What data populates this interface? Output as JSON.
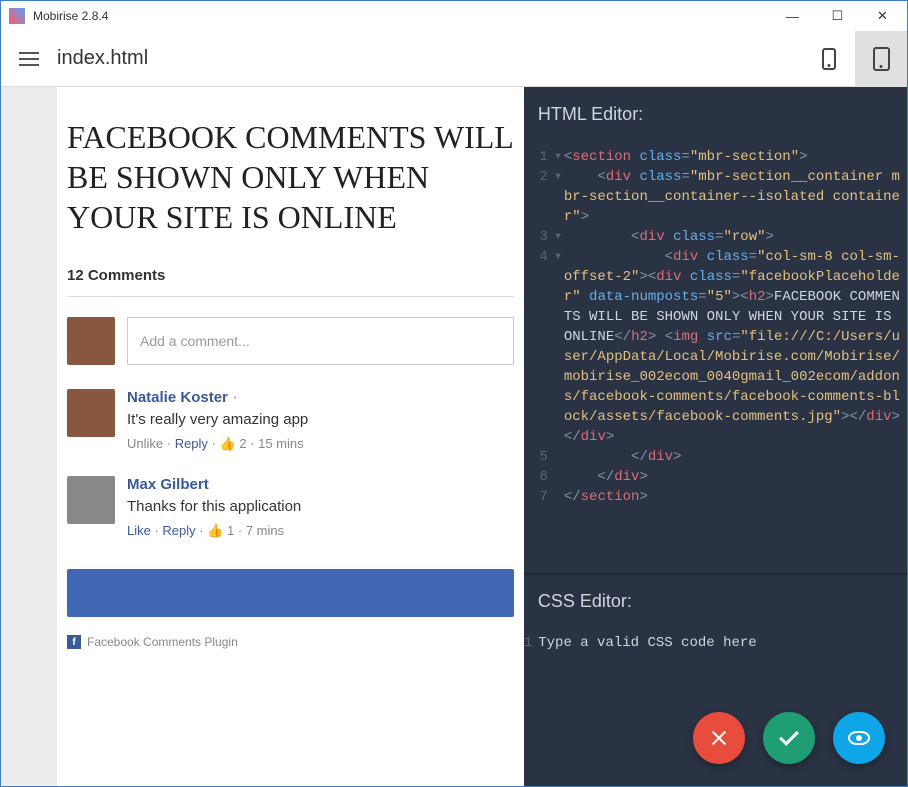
{
  "window": {
    "title": "Mobirise 2.8.4"
  },
  "toolbar": {
    "filename": "index.html"
  },
  "preview": {
    "headline_l1": "FACEBOOK COMMENTS WILL",
    "headline_l2": "BE SHOWN ONLY WHEN",
    "headline_l3": "YOUR SITE IS ONLINE",
    "comments_count": "12 Comments",
    "add_placeholder": "Add a comment...",
    "comments": [
      {
        "name": "Natalie Koster",
        "text": "It's really very amazing app",
        "action1": "Unlike",
        "action2": "Reply",
        "likes": "2",
        "time": "15 mins"
      },
      {
        "name": "Max Gilbert",
        "text": "Thanks for this application",
        "action1": "Like",
        "action2": "Reply",
        "likes": "1",
        "time": "7 mins"
      }
    ],
    "plugin_label": "Facebook Comments Plugin"
  },
  "html_editor": {
    "title": "HTML Editor:",
    "lines": {
      "l1": {
        "tag": "section",
        "attr": "class",
        "val": "\"mbr-section\""
      },
      "l2": {
        "tag": "div",
        "attr": "class",
        "val": "\"mbr-section__container mbr-section__container--isolated container\""
      },
      "l3": {
        "tag": "div",
        "attr": "class",
        "val": "\"row\""
      },
      "l4": {
        "tag_div": "div",
        "attr_class": "class",
        "val_col": "\"col-sm-8 col-sm-offset-2\"",
        "val_fb": "\"facebookPlaceholder\"",
        "attr_numposts": "data-numposts",
        "val_numposts": "\"5\"",
        "tag_h2": "h2",
        "h2_text": "FACEBOOK COMMENTS WILL BE SHOWN ONLY WHEN YOUR SITE IS ONLINE",
        "tag_img": "img",
        "attr_src": "src",
        "val_src": "\"file:///C:/Users/user/AppData/Local/Mobirise.com/Mobirise/mobirise_002ecom_0040gmail_002ecom/addons/facebook-comments/facebook-comments-block/assets/facebook-comments.jpg\""
      },
      "l5": {
        "close": "div"
      },
      "l6": {
        "close": "div"
      },
      "l7": {
        "close": "section"
      }
    }
  },
  "css_editor": {
    "title": "CSS Editor:",
    "placeholder": "Type a valid CSS code here"
  }
}
